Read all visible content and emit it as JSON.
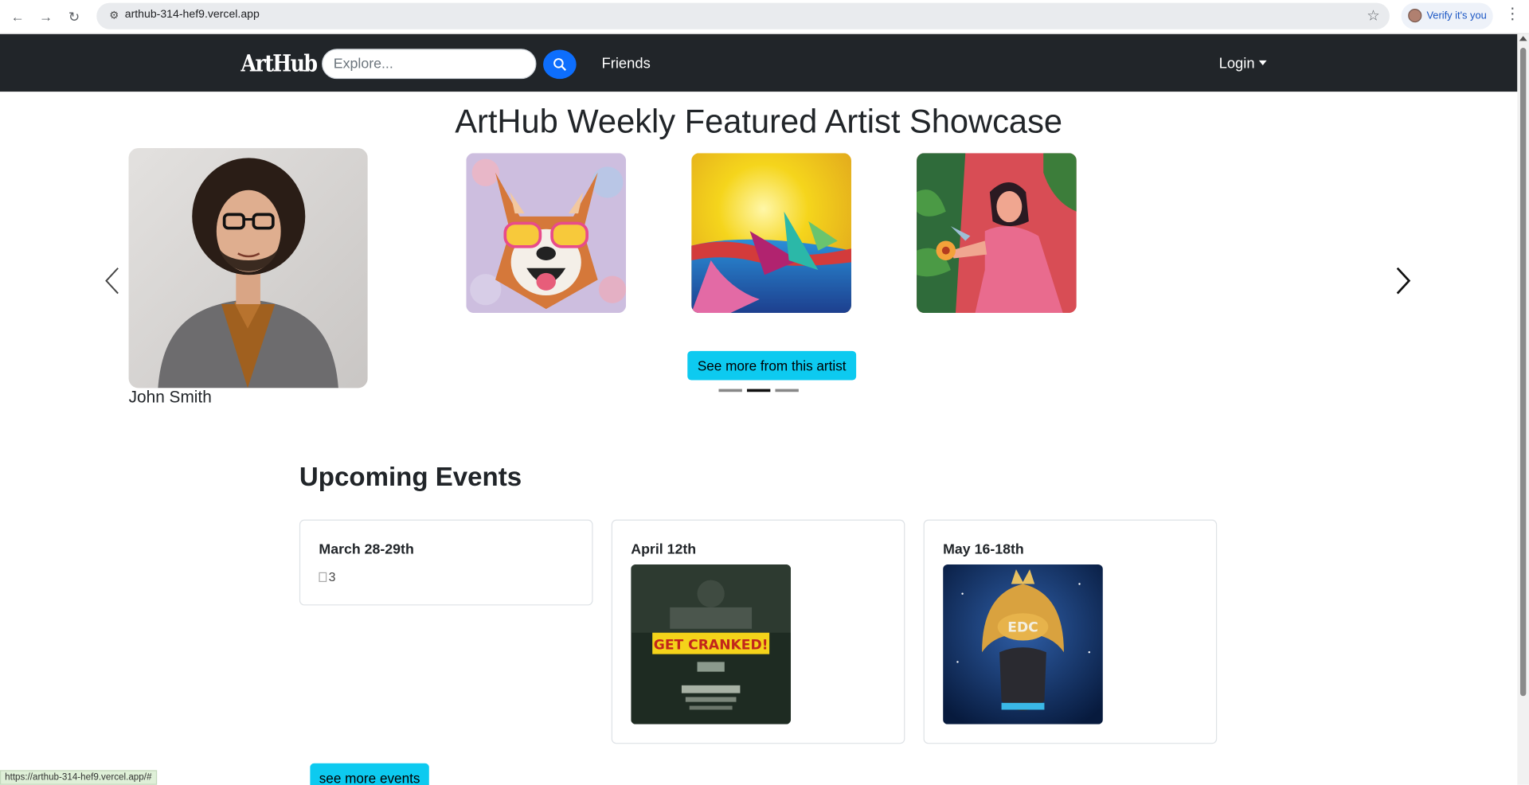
{
  "browser": {
    "url": "arthub-314-hef9.vercel.app",
    "verify_label": "Verify it's you",
    "status_url": "https://arthub-314-hef9.vercel.app/#"
  },
  "navbar": {
    "brand": "ArtHub",
    "search_placeholder": "Explore...",
    "friends_label": "Friends",
    "login_label": "Login"
  },
  "showcase": {
    "title": "ArtHub Weekly Featured Artist Showcase",
    "artist_name": "John Smith",
    "see_more_label": "See more from this artist",
    "artworks": [
      "shiba-dog-painting",
      "abstract-sunset-painting",
      "woman-in-garden-painting"
    ],
    "indicator_count": 3,
    "active_indicator": 2
  },
  "events": {
    "title": "Upcoming Events",
    "cards": [
      {
        "date": "March 28-29th",
        "image_alt": "3"
      },
      {
        "date": "April 12th",
        "poster_text": "GET CRANKED!"
      },
      {
        "date": "May 16-18th",
        "poster_text": "EDC"
      }
    ],
    "see_more_label": "see more events"
  },
  "colors": {
    "navbar_bg": "#212529",
    "primary": "#0d6efd",
    "info": "#0dcaf0"
  }
}
